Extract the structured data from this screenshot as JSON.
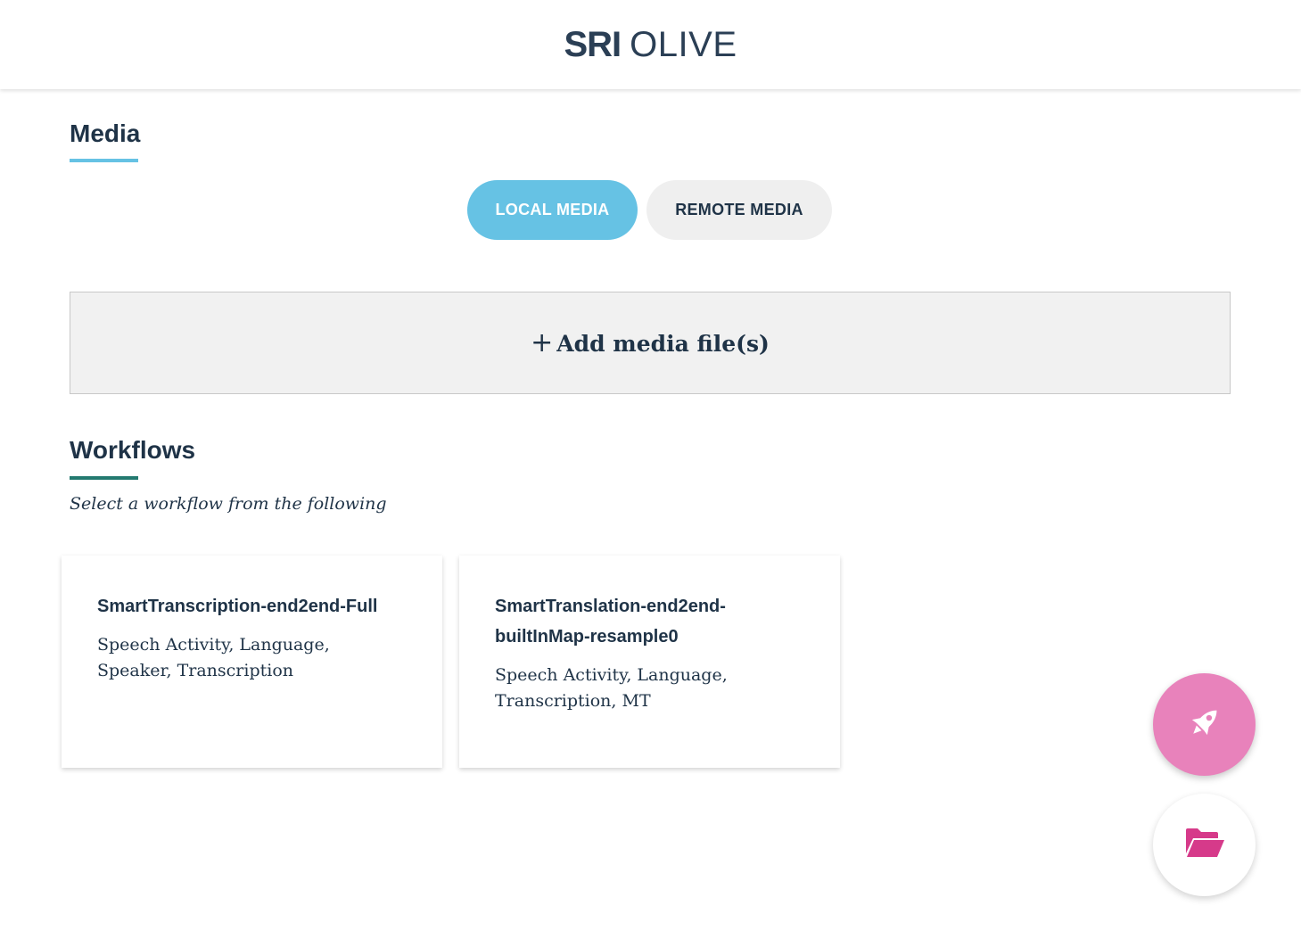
{
  "header": {
    "brand_bold": "SRI",
    "brand_light": "OLIVE"
  },
  "media": {
    "title": "Media",
    "tabs": {
      "local": "LOCAL MEDIA",
      "remote": "REMOTE MEDIA"
    },
    "add_plus": "+",
    "add_label": "Add media file(s)"
  },
  "workflows": {
    "title": "Workflows",
    "subtitle": "Select a workflow from the following",
    "cards": [
      {
        "name": "SmartTranscription-end2end-Full",
        "desc": "Speech Activity, Language, Speaker, Transcription"
      },
      {
        "name": "SmartTranslation-end2end-builtInMap-resample0",
        "desc": "Speech Activity, Language, Transcription, MT"
      }
    ]
  },
  "fabs": {
    "primary_icon": "rocket-icon",
    "secondary_icon": "folder-open-icon"
  },
  "colors": {
    "accent_blue": "#66c2e4",
    "accent_green": "#237a70",
    "fab_pink": "#e882bb",
    "folder_pink": "#d63a8a",
    "navy": "#1f3347"
  }
}
